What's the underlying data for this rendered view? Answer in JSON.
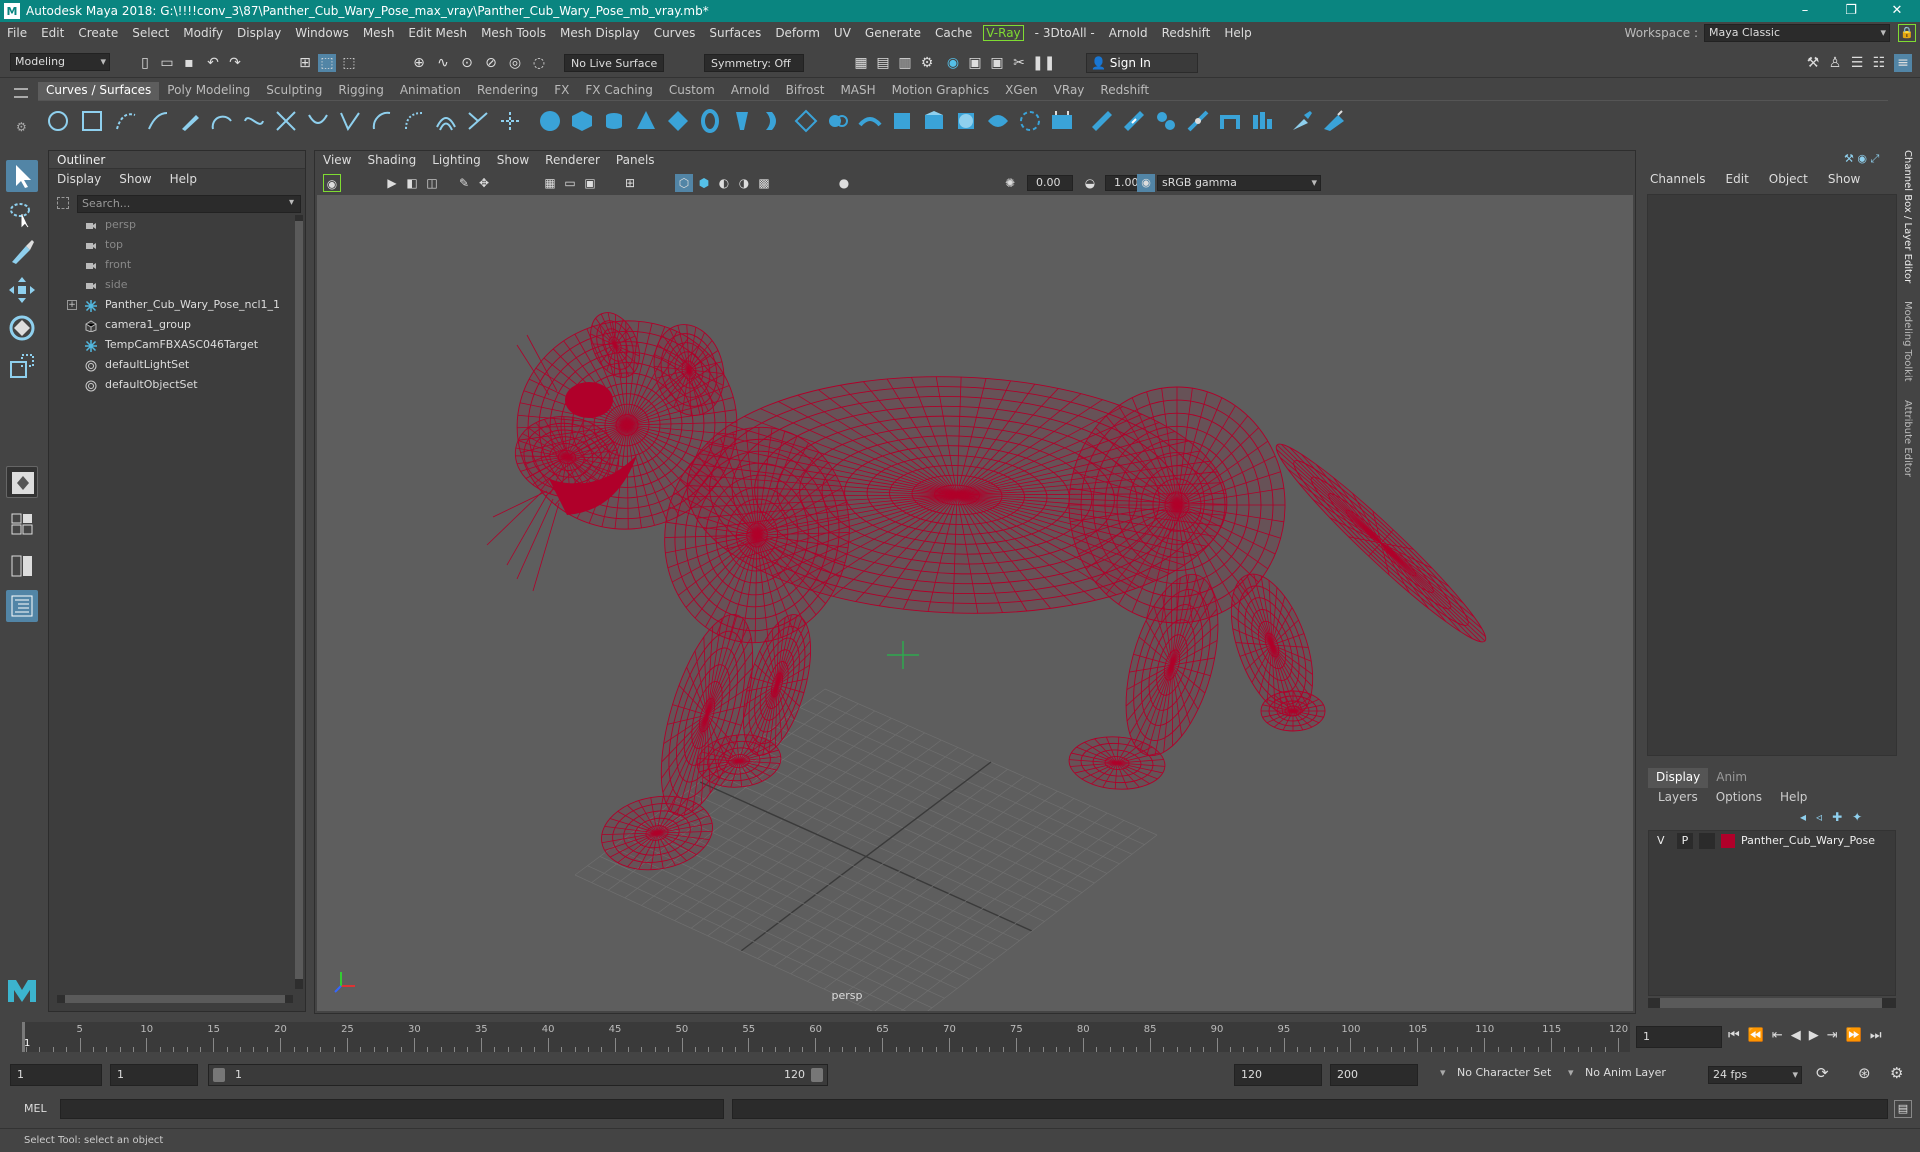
{
  "title_bar": {
    "app_icon": "M",
    "title": "Autodesk Maya 2018: G:\\!!!!conv_3\\87\\Panther_Cub_Wary_Pose_max_vray\\Panther_Cub_Wary_Pose_mb_vray.mb*",
    "minimize": "–",
    "restore": "❐",
    "close": "✕"
  },
  "menu": [
    "File",
    "Edit",
    "Create",
    "Select",
    "Modify",
    "Display",
    "Windows",
    "Mesh",
    "Edit Mesh",
    "Mesh Tools",
    "Mesh Display",
    "Curves",
    "Surfaces",
    "Deform",
    "UV",
    "Generate",
    "Cache"
  ],
  "menu_vray": "V-Ray",
  "menu_after": [
    "- 3DtoAll -",
    "Arnold",
    "Redshift",
    "Help"
  ],
  "workspace": {
    "label": "Workspace :",
    "value": "Maya Classic"
  },
  "status": {
    "mode": "Modeling",
    "live_surface": "No Live Surface",
    "symmetry": "Symmetry: Off",
    "sign_in": "Sign In"
  },
  "shelf_tabs": [
    "Curves / Surfaces",
    "Poly Modeling",
    "Sculpting",
    "Rigging",
    "Animation",
    "Rendering",
    "FX",
    "FX Caching",
    "Custom",
    "Arnold",
    "Bifrost",
    "MASH",
    "Motion Graphics",
    "XGen",
    "VRay",
    "Redshift"
  ],
  "outliner": {
    "title": "Outliner",
    "menu": [
      "Display",
      "Show",
      "Help"
    ],
    "search_placeholder": "Search...",
    "items": [
      {
        "label": "persp",
        "kind": "camera",
        "dim": true
      },
      {
        "label": "top",
        "kind": "camera",
        "dim": true
      },
      {
        "label": "front",
        "kind": "camera",
        "dim": true
      },
      {
        "label": "side",
        "kind": "camera",
        "dim": true
      },
      {
        "label": "Panther_Cub_Wary_Pose_ncl1_1",
        "kind": "joint",
        "dim": false,
        "expandable": true
      },
      {
        "label": "camera1_group",
        "kind": "group",
        "dim": false
      },
      {
        "label": "TempCamFBXASC046Target",
        "kind": "joint",
        "dim": false
      },
      {
        "label": "defaultLightSet",
        "kind": "set",
        "dim": false
      },
      {
        "label": "defaultObjectSet",
        "kind": "set",
        "dim": false
      }
    ]
  },
  "viewport": {
    "menu": [
      "View",
      "Shading",
      "Lighting",
      "Show",
      "Renderer",
      "Panels"
    ],
    "exposure": "0.00",
    "gamma": "1.00",
    "colorspace": "sRGB gamma",
    "camera_label": "persp",
    "wire_color": "#b0002a"
  },
  "channel_box": {
    "menu": [
      "Channels",
      "Edit",
      "Object",
      "Show"
    ],
    "side_tabs": [
      "Channel Box / Layer Editor",
      "Modeling Toolkit",
      "Attribute Editor"
    ]
  },
  "layers": {
    "tabs": [
      "Display",
      "Anim"
    ],
    "menu": [
      "Layers",
      "Options",
      "Help"
    ],
    "layer": {
      "v": "V",
      "p": "P",
      "name": "Panther_Cub_Wary_Pose",
      "color": "#b0002a"
    }
  },
  "timeline": {
    "ticks": [
      "5",
      "10",
      "15",
      "20",
      "25",
      "30",
      "35",
      "40",
      "45",
      "50",
      "55",
      "60",
      "65",
      "70",
      "75",
      "80",
      "85",
      "90",
      "95",
      "100",
      "105",
      "110",
      "115",
      "120"
    ],
    "current_frame": "1",
    "frame_field": "1"
  },
  "range": {
    "start": "1",
    "playback_start": "1",
    "slider_start": "1",
    "slider_end": "120",
    "playback_end": "120",
    "end": "200",
    "character_set": "No Character Set",
    "anim_layer": "No Anim Layer",
    "fps": "24 fps"
  },
  "command": {
    "lang": "MEL"
  },
  "help": {
    "text": "Select Tool: select an object"
  }
}
